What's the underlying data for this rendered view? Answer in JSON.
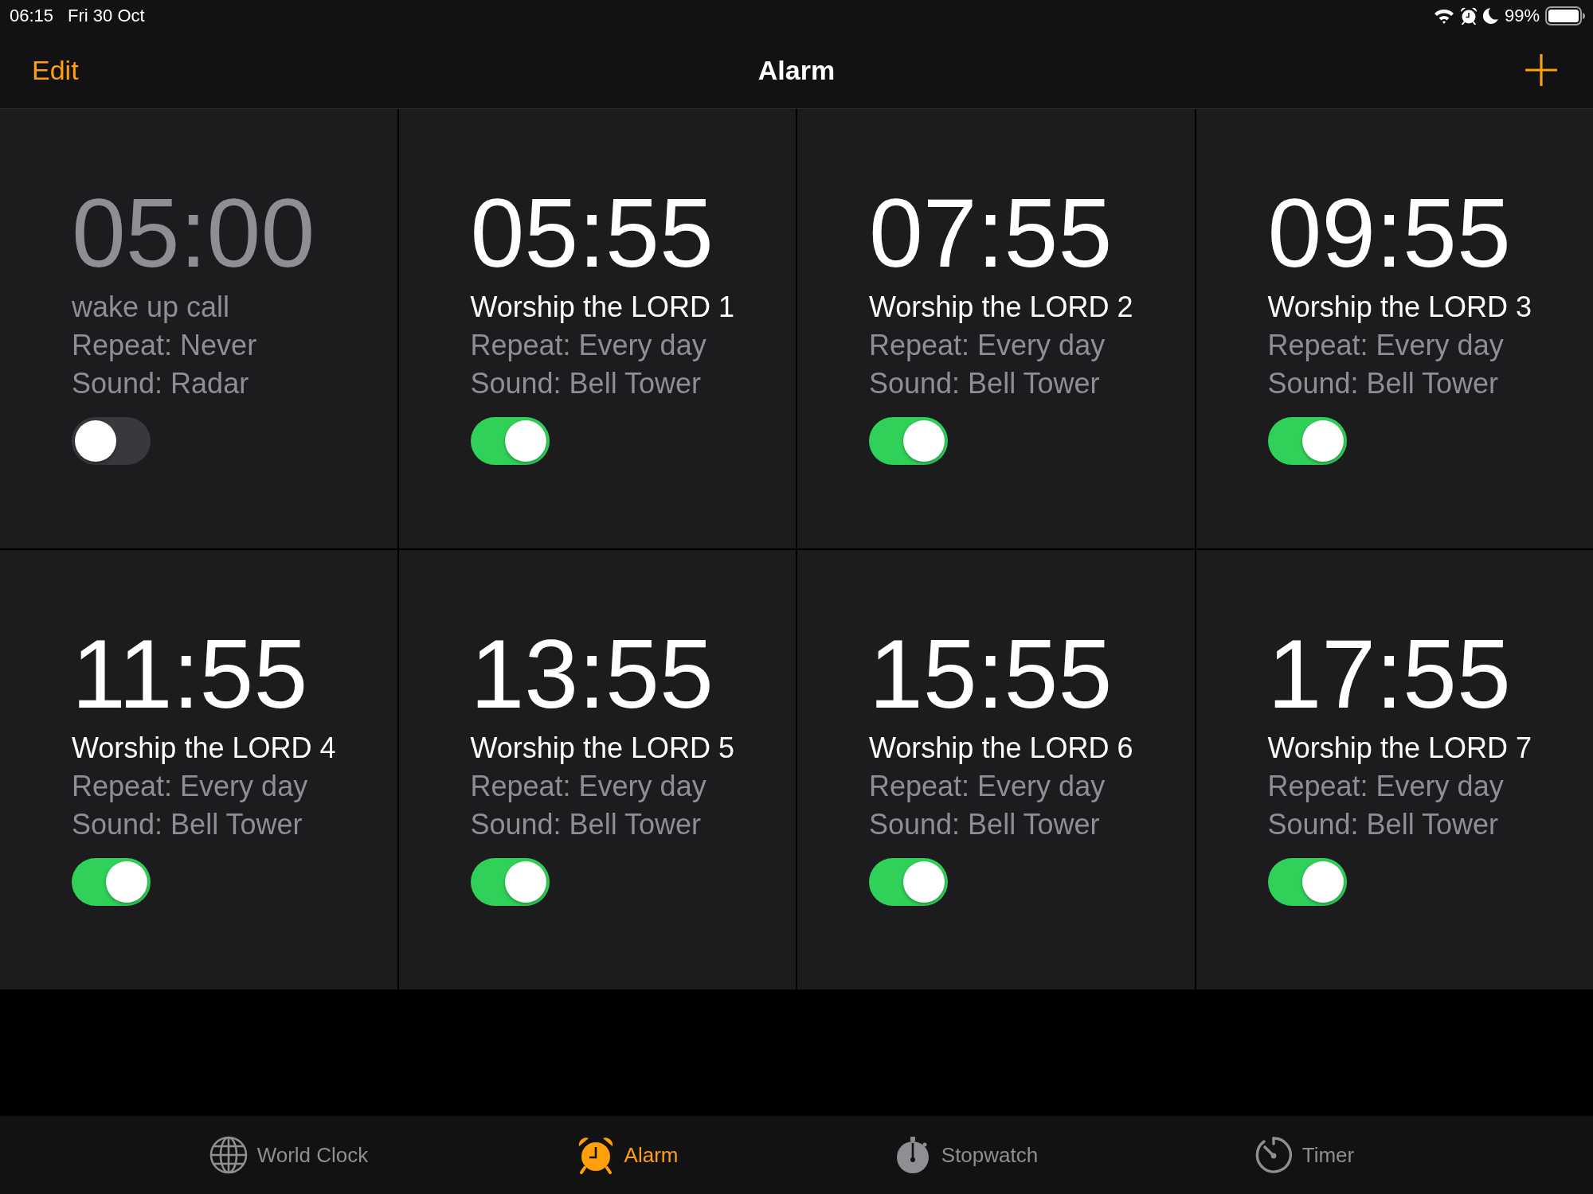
{
  "status_bar": {
    "time": "06:15",
    "date": "Fri 30 Oct",
    "battery": "99%"
  },
  "nav_bar": {
    "edit": "Edit",
    "title": "Alarm"
  },
  "alarms": [
    {
      "time": "05:00",
      "label": "wake up call",
      "repeat": "Repeat: Never",
      "sound": "Sound: Radar",
      "on": false
    },
    {
      "time": "05:55",
      "label": "Worship the LORD 1",
      "repeat": "Repeat: Every day",
      "sound": "Sound: Bell Tower",
      "on": true
    },
    {
      "time": "07:55",
      "label": "Worship the LORD 2",
      "repeat": "Repeat: Every day",
      "sound": "Sound: Bell Tower",
      "on": true
    },
    {
      "time": "09:55",
      "label": "Worship the LORD 3",
      "repeat": "Repeat: Every day",
      "sound": "Sound: Bell Tower",
      "on": true
    },
    {
      "time": "11:55",
      "label": "Worship the LORD 4",
      "repeat": "Repeat: Every day",
      "sound": "Sound: Bell Tower",
      "on": true
    },
    {
      "time": "13:55",
      "label": "Worship the LORD 5",
      "repeat": "Repeat: Every day",
      "sound": "Sound: Bell Tower",
      "on": true
    },
    {
      "time": "15:55",
      "label": "Worship the LORD 6",
      "repeat": "Repeat: Every day",
      "sound": "Sound: Bell Tower",
      "on": true
    },
    {
      "time": "17:55",
      "label": "Worship the LORD 7",
      "repeat": "Repeat: Every day",
      "sound": "Sound: Bell Tower",
      "on": true
    }
  ],
  "tab_bar": [
    {
      "label": "World Clock",
      "selected": false
    },
    {
      "label": "Alarm",
      "selected": true
    },
    {
      "label": "Stopwatch",
      "selected": false
    },
    {
      "label": "Timer",
      "selected": false
    }
  ]
}
